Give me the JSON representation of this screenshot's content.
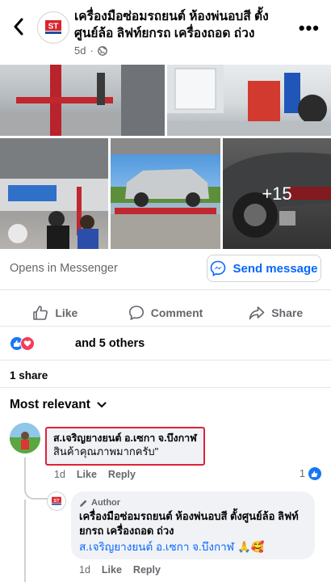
{
  "header": {
    "title": "เครื่องมือซ่อมรถยนต์ ห้องพ่นอบสี ตั้งศูนย์ล้อ ลิฟท์ยกรถ เครื่องถอด ถ่วง",
    "time": "5d",
    "privacy_icon": "globe-icon",
    "logo_text": "ST"
  },
  "photos": {
    "overlay_count": "+15"
  },
  "messenger": {
    "opens_text": "Opens in Messenger",
    "send_label": "Send message"
  },
  "actions": {
    "like": "Like",
    "comment": "Comment",
    "share": "Share"
  },
  "reactions": {
    "text": "and 5 others"
  },
  "shares": {
    "text": "1 share"
  },
  "sort": {
    "label": "Most relevant"
  },
  "comment": {
    "author": "ส.เจริญยางยนต์ อ.เซกา จ.บึงกาฬ",
    "text": "สินค้าคุณภาพมากครับ\"",
    "time": "1d",
    "like_label": "Like",
    "reply_label": "Reply",
    "like_count": "1"
  },
  "reply": {
    "badge": "Author",
    "author": "เครื่องมือซ่อมรถยนต์ ห้องพ่นอบสี ตั้งศูนย์ล้อ ลิฟท์ยกรถ เครื่องถอด ถ่วง",
    "mention": "ส.เจริญยางยนต์ อ.เซกา จ.บึงกาฬ",
    "emoji": "🙏🥰",
    "time": "1d",
    "like_label": "Like",
    "reply_label": "Reply"
  },
  "colors": {
    "accent": "#0866ff",
    "like_blue": "#1877f2",
    "love_red": "#f33e58",
    "highlight_border": "#e0213a",
    "secondary_text": "#65676b"
  }
}
